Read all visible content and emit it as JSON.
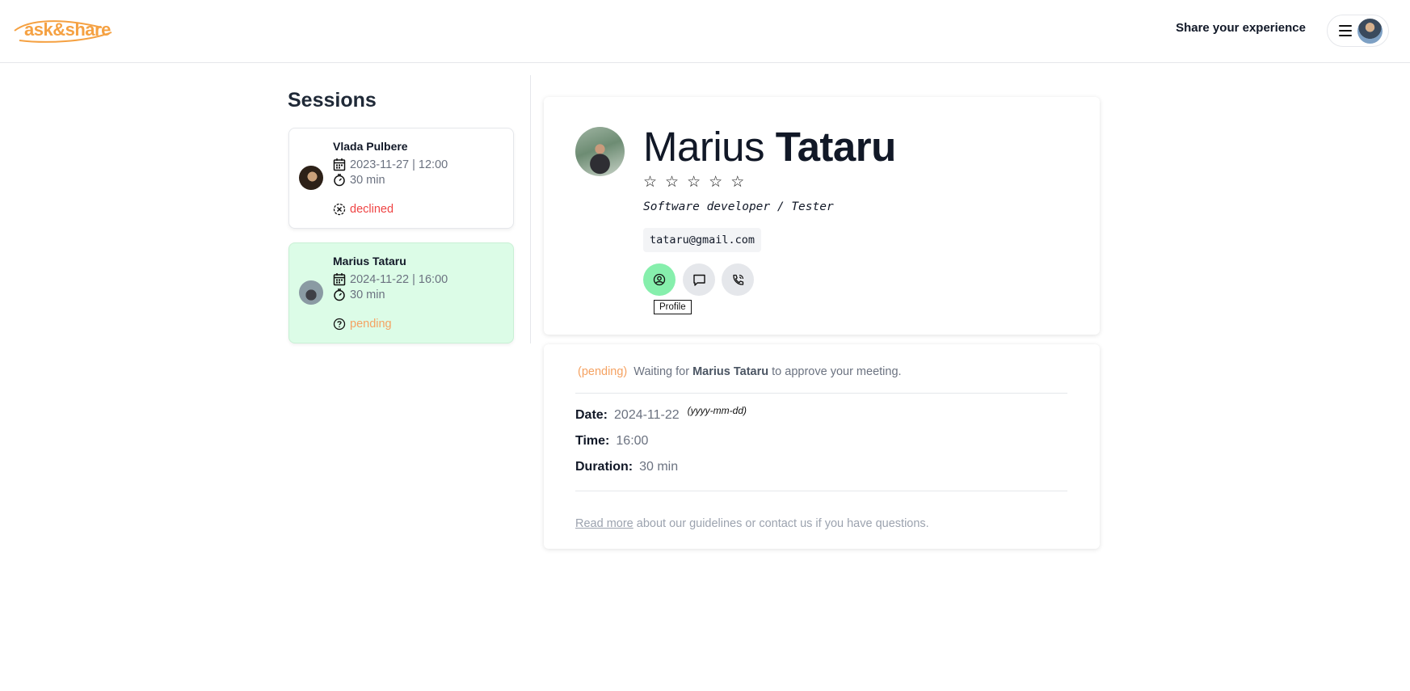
{
  "header": {
    "logo_text": "ask&share",
    "share_link": "Share your experience"
  },
  "sessions": {
    "title": "Sessions",
    "items": [
      {
        "name": "Vlada Pulbere",
        "datetime": "2023-11-27 | 12:00",
        "duration": "30 min",
        "status": "declined",
        "status_color": "#ef4444",
        "status_icon": "x-circle-icon",
        "selected": false
      },
      {
        "name": "Marius Tataru",
        "datetime": "2024-11-22 | 16:00",
        "duration": "30 min",
        "status": "pending",
        "status_color": "#f5a262",
        "status_icon": "question-circle-icon",
        "selected": true
      }
    ]
  },
  "profile": {
    "first_name": "Marius",
    "last_name": "Tataru",
    "rating_stars": 5,
    "rating_filled": 0,
    "role": "Software developer / Tester",
    "email": "tataru@gmail.com",
    "actions": [
      {
        "icon": "user-circle-icon",
        "active": true
      },
      {
        "icon": "chat-icon",
        "active": false
      },
      {
        "icon": "phone-icon",
        "active": false
      }
    ],
    "tooltip": "Profile"
  },
  "details": {
    "status_tag": "(pending)",
    "message_prefix": "Waiting for",
    "message_name": "Marius Tataru",
    "message_suffix": "to approve your meeting.",
    "date_label": "Date:",
    "date_value": "2024-11-22",
    "date_hint": "(yyyy-mm-dd)",
    "time_label": "Time:",
    "time_value": "16:00",
    "duration_label": "Duration:",
    "duration_value": "30 min",
    "footer_link": "Read more",
    "footer_text": "about our guidelines or contact us if you have questions."
  },
  "colors": {
    "brand": "#f5a142",
    "selected_card": "#dcfce7",
    "primary_action": "#86efac",
    "pending": "#f5a262",
    "declined": "#ef4444"
  }
}
